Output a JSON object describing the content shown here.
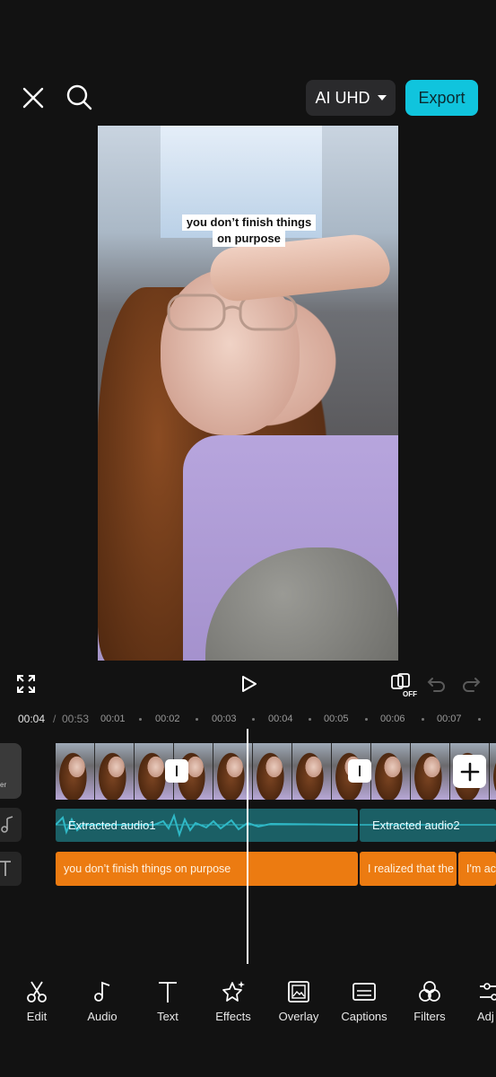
{
  "header": {
    "close_icon": "close-icon",
    "search_icon": "search-icon",
    "quality_label": "AI UHD",
    "export_label": "Export",
    "accent_color": "#10c4dd"
  },
  "preview": {
    "caption_line1": "you don’t finish things",
    "caption_line2": "on purpose"
  },
  "controls": {
    "fullscreen_icon": "fullscreen-icon",
    "play_icon": "play-icon",
    "keyframe_icon": "keyframe-off-icon",
    "keyframe_badge": "OFF",
    "undo_icon": "undo-icon",
    "redo_icon": "redo-icon"
  },
  "timeline": {
    "current_time": "00:04",
    "separator": "/",
    "total_time": "00:53",
    "ticks": [
      "00:01",
      "00:02",
      "00:03",
      "00:04",
      "00:05",
      "00:06",
      "00:07"
    ],
    "cover_label": "er",
    "audio_clips": [
      "Extracted audio1",
      "Extracted audio2"
    ],
    "text_clips": [
      "you don’t finish things on purpose",
      "I realized that the",
      "I'm ac"
    ],
    "audio_color": "#1b5f65",
    "text_color": "#ec7b11"
  },
  "toolbar": {
    "items": [
      {
        "label": "Edit",
        "icon": "scissors-icon"
      },
      {
        "label": "Audio",
        "icon": "music-note-icon"
      },
      {
        "label": "Text",
        "icon": "text-icon"
      },
      {
        "label": "Effects",
        "icon": "sparkle-star-icon"
      },
      {
        "label": "Overlay",
        "icon": "overlay-icon"
      },
      {
        "label": "Captions",
        "icon": "captions-icon"
      },
      {
        "label": "Filters",
        "icon": "filters-icon"
      },
      {
        "label": "Adj",
        "icon": "adjust-icon"
      }
    ]
  }
}
